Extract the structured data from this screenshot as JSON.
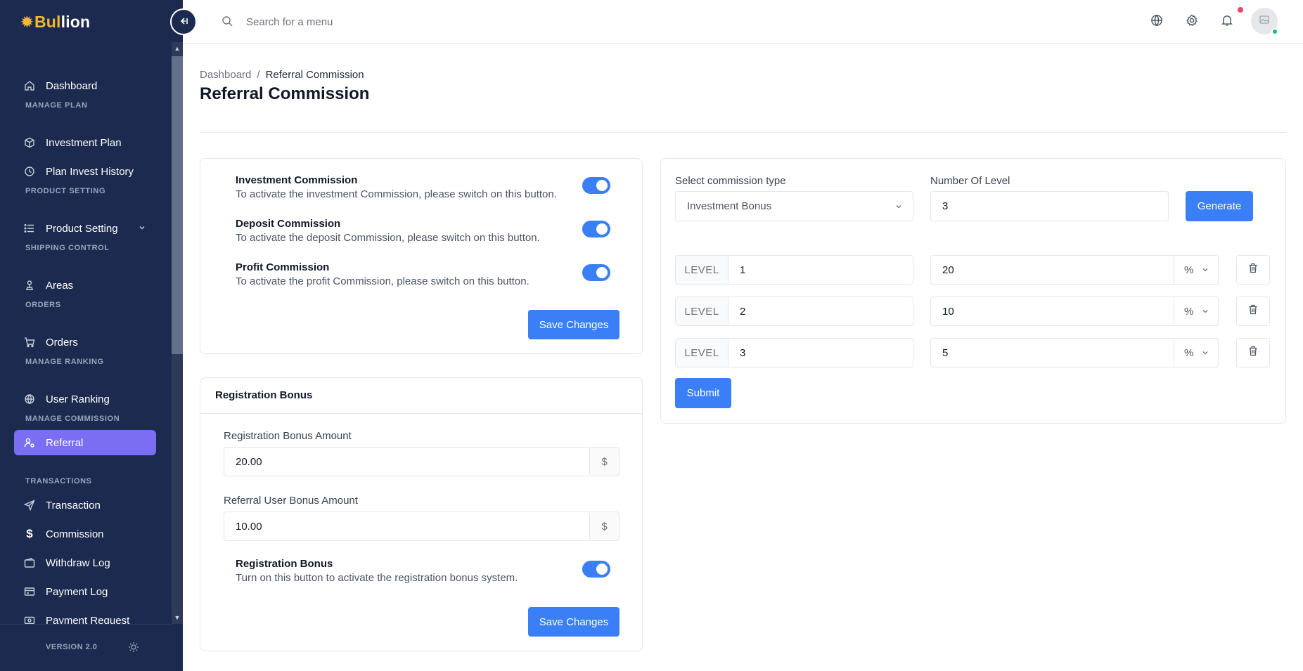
{
  "app": {
    "logo_prefix": "Bul",
    "logo_suffix": "lion",
    "version": "VERSION 2.0"
  },
  "sidebar": {
    "items": [
      {
        "label": "Dashboard",
        "icon": "home-icon"
      },
      {
        "heading": "MANAGE PLAN"
      },
      {
        "label": "Investment Plan",
        "icon": "box-icon"
      },
      {
        "label": "Plan Invest History",
        "icon": "clock-icon"
      },
      {
        "heading": "PRODUCT SETTING"
      },
      {
        "label": "Product Setting",
        "icon": "list-icon"
      },
      {
        "heading": "SHIPPING CONTROL"
      },
      {
        "label": "Areas",
        "icon": "map-pin-icon"
      },
      {
        "heading": "ORDERS"
      },
      {
        "label": "Orders",
        "icon": "cart-icon"
      },
      {
        "heading": "MANAGE RANKING"
      },
      {
        "label": "User Ranking",
        "icon": "globe-icon"
      },
      {
        "heading": "MANAGE COMMISSION"
      },
      {
        "label": "Referral",
        "icon": "user-gear-icon",
        "active": true
      },
      {
        "heading": "TRANSACTIONS"
      },
      {
        "label": "Transaction",
        "icon": "send-icon"
      },
      {
        "label": "Commission",
        "icon": "dollar-icon"
      },
      {
        "label": "Withdraw Log",
        "icon": "wallet-icon"
      },
      {
        "label": "Payment Log",
        "icon": "card-icon"
      },
      {
        "label": "Payment Request",
        "icon": "money-icon"
      }
    ]
  },
  "topbar": {
    "search_placeholder": "Search for a menu"
  },
  "breadcrumb": {
    "home": "Dashboard",
    "separator": "/",
    "current": "Referral Commission"
  },
  "page_title": "Referral Commission",
  "commission_card": {
    "toggles": [
      {
        "title": "Investment Commission",
        "desc": "To activate the investment Commission, please switch on this button.",
        "on": true
      },
      {
        "title": "Deposit Commission",
        "desc": "To activate the deposit Commission, please switch on this button.",
        "on": true
      },
      {
        "title": "Profit Commission",
        "desc": "To activate the profit Commission, please switch on this button.",
        "on": true
      }
    ],
    "save_label": "Save Changes"
  },
  "registration_card": {
    "title": "Registration Bonus",
    "bonus_amount_label": "Registration Bonus Amount",
    "bonus_amount_value": "20.00",
    "currency_symbol": "$",
    "referral_amount_label": "Referral User Bonus Amount",
    "referral_amount_value": "10.00",
    "toggle_title": "Registration Bonus",
    "toggle_desc": "Turn on this button to activate the registration bonus system.",
    "toggle_on": true,
    "save_label": "Save Changes"
  },
  "level_card": {
    "type_label": "Select commission type",
    "type_value": "Investment Bonus",
    "level_count_label": "Number Of Level",
    "level_count_value": "3",
    "generate_label": "Generate",
    "level_prefix": "LEVEL",
    "levels": [
      {
        "level": "1",
        "value": "20",
        "unit": "%"
      },
      {
        "level": "2",
        "value": "10",
        "unit": "%"
      },
      {
        "level": "3",
        "value": "5",
        "unit": "%"
      }
    ],
    "submit_label": "Submit"
  },
  "colors": {
    "sidebar_bg": "#1b2a4e",
    "accent": "#3b7ff6",
    "active_nav": "#7c6ef2",
    "logo_gold": "#f5b82e"
  }
}
